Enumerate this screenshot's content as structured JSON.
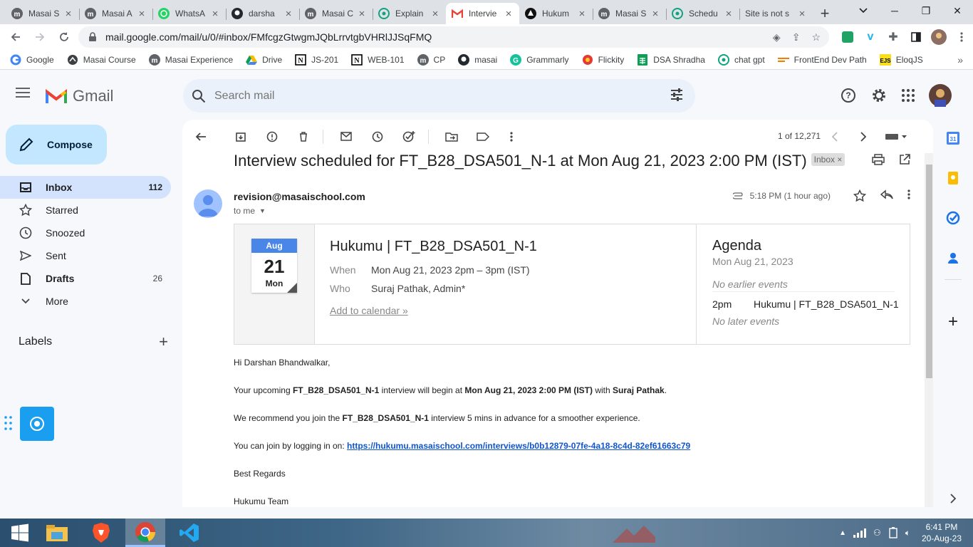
{
  "browser": {
    "tabs": [
      {
        "label": "Masai S",
        "icon": "masai-icon"
      },
      {
        "label": "Masai A",
        "icon": "masai-icon"
      },
      {
        "label": "WhatsA",
        "icon": "whatsapp-icon"
      },
      {
        "label": "darsha",
        "icon": "github-icon"
      },
      {
        "label": "Masai C",
        "icon": "masai-icon"
      },
      {
        "label": "Explain",
        "icon": "chatgpt-icon"
      },
      {
        "label": "Intervie",
        "icon": "gmail-icon",
        "active": true
      },
      {
        "label": "Hukum",
        "icon": "hukumu-icon"
      },
      {
        "label": "Masai S",
        "icon": "masai-icon"
      },
      {
        "label": "Schedu",
        "icon": "chatgpt-icon"
      },
      {
        "label": "Site is not s",
        "icon": "none"
      }
    ],
    "url": "mail.google.com/mail/u/0/#inbox/FMfcgzGtwgmJQbLrrvtgbVHRlJJSqFMQ",
    "bookmarks": [
      {
        "label": "Google",
        "icon": "google-icon"
      },
      {
        "label": "Masai Course",
        "icon": "masai-course-icon"
      },
      {
        "label": "Masai Experience",
        "icon": "masai-icon"
      },
      {
        "label": "Drive",
        "icon": "drive-icon"
      },
      {
        "label": "JS-201",
        "icon": "notion-icon"
      },
      {
        "label": "WEB-101",
        "icon": "notion-icon"
      },
      {
        "label": "CP",
        "icon": "masai-icon"
      },
      {
        "label": "masai",
        "icon": "github-icon"
      },
      {
        "label": "Grammarly",
        "icon": "grammarly-icon"
      },
      {
        "label": "Flickity",
        "icon": "flickity-icon"
      },
      {
        "label": "DSA Shradha",
        "icon": "sheets-icon"
      },
      {
        "label": "chat gpt",
        "icon": "chatgpt-icon"
      },
      {
        "label": "FrontEnd Dev Path",
        "icon": "path-icon"
      },
      {
        "label": "EloqJS",
        "icon": "ejs-icon"
      }
    ],
    "bookmarks_more": "»"
  },
  "gmail": {
    "logo_text": "Gmail",
    "search_placeholder": "Search mail",
    "compose_label": "Compose",
    "nav": [
      {
        "label": "Inbox",
        "count": "112",
        "icon": "inbox-icon",
        "active": true
      },
      {
        "label": "Starred",
        "count": "",
        "icon": "star-icon"
      },
      {
        "label": "Snoozed",
        "count": "",
        "icon": "clock-icon"
      },
      {
        "label": "Sent",
        "count": "",
        "icon": "send-icon"
      },
      {
        "label": "Drafts",
        "count": "26",
        "icon": "draft-icon",
        "bold": true
      },
      {
        "label": "More",
        "count": "",
        "icon": "chevron-down-icon"
      }
    ],
    "labels_heading": "Labels",
    "pager": "1 of 12,271"
  },
  "message": {
    "subject": "Interview scheduled for FT_B28_DSA501_N-1 at Mon Aug 21, 2023 2:00 PM (IST)",
    "folder_chip": "Inbox",
    "chip_close": "×",
    "sender": "revision@masaischool.com",
    "to": "to me",
    "time": "5:18 PM (1 hour ago)",
    "invite": {
      "month": "Aug",
      "day": "21",
      "weekday": "Mon",
      "title": "Hukumu | FT_B28_DSA501_N-1",
      "when_label": "When",
      "when_value": "Mon Aug 21, 2023 2pm – 3pm (IST)",
      "who_label": "Who",
      "who_value": "Suraj Pathak, Admin*",
      "add_link": "Add to calendar »",
      "agenda_title": "Agenda",
      "agenda_date": "Mon Aug 21, 2023",
      "no_earlier": "No earlier events",
      "agenda_time": "2pm",
      "agenda_event": "Hukumu | FT_B28_DSA501_N-1",
      "no_later": "No later events"
    },
    "body": {
      "greeting": "Hi Darshan Bhandwalkar,",
      "l1_a": "Your upcoming ",
      "l1_b": "FT_B28_DSA501_N-1",
      "l1_c": " interview will begin at ",
      "l1_d": "Mon Aug 21, 2023 2:00 PM (IST)",
      "l1_e": " with ",
      "l1_f": "Suraj Pathak",
      "l1_g": ".",
      "l2_a": "We recommend you join the ",
      "l2_b": "FT_B28_DSA501_N-1",
      "l2_c": " interview 5 mins in advance for a smoother experience.",
      "l3_a": "You can join by logging in on: ",
      "l3_link": "https://hukumu.masaischool.com/interviews/b0b12879-07fe-4a18-8c4d-82ef61663c79",
      "regards": "Best Regards",
      "team": "Hukumu Team"
    }
  },
  "taskbar": {
    "time": "6:41 PM",
    "date": "20-Aug-23"
  },
  "colors": {
    "compose_bg": "#c2e7ff",
    "active_nav": "#d3e3fd",
    "calendar_accent": "#4a86e8",
    "link": "#1155cc"
  }
}
